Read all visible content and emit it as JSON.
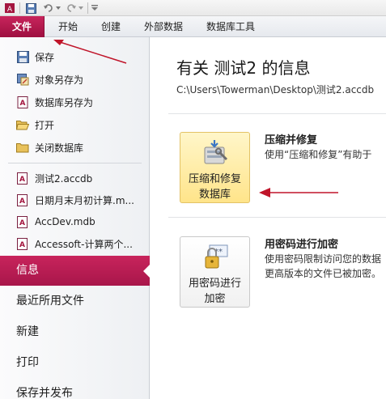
{
  "quick_access": {
    "icons": [
      "app-icon",
      "save-icon",
      "undo-icon",
      "redo-icon",
      "customize-icon"
    ]
  },
  "ribbon_tabs": [
    {
      "label": "文件"
    },
    {
      "label": "开始"
    },
    {
      "label": "创建"
    },
    {
      "label": "外部数据"
    },
    {
      "label": "数据库工具"
    }
  ],
  "file_commands": [
    {
      "label": "保存",
      "icon": "save-icon"
    },
    {
      "label": "对象另存为",
      "icon": "save-object-as-icon"
    },
    {
      "label": "数据库另存为",
      "icon": "save-database-as-icon"
    },
    {
      "label": "打开",
      "icon": "open-folder-icon"
    },
    {
      "label": "关闭数据库",
      "icon": "close-database-icon"
    }
  ],
  "recent_files": [
    {
      "label": "测试2.accdb"
    },
    {
      "label": "日期月末月初计算.m..."
    },
    {
      "label": "AccDev.mdb"
    },
    {
      "label": "Accessoft-计算两个..."
    }
  ],
  "nav_tabs": [
    {
      "label": "信息",
      "active": true
    },
    {
      "label": "最近所用文件",
      "active": false
    },
    {
      "label": "新建",
      "active": false
    },
    {
      "label": "打印",
      "active": false
    },
    {
      "label": "保存并发布",
      "active": false
    }
  ],
  "info": {
    "title": "有关 测试2 的信息",
    "path": "C:\\Users\\Towerman\\Desktop\\测试2.accdb"
  },
  "sections": [
    {
      "button_label_line1": "压缩和修复",
      "button_label_line2": "数据库",
      "title": "压缩并修复",
      "desc_line1": "使用“压缩和修复”有助于",
      "icon": "compact-repair-icon"
    },
    {
      "button_label_line1": "用密码进行",
      "button_label_line2": "加密",
      "title": "用密码进行加密",
      "desc_line1": "使用密码限制访问您的数据",
      "desc_line2": "更高版本的文件已被加密。",
      "icon": "encrypt-password-icon"
    }
  ],
  "colors": {
    "accent": "#b0184c",
    "annotation_arrow": "#c0152a",
    "highlight_button": "#ffe48a"
  }
}
